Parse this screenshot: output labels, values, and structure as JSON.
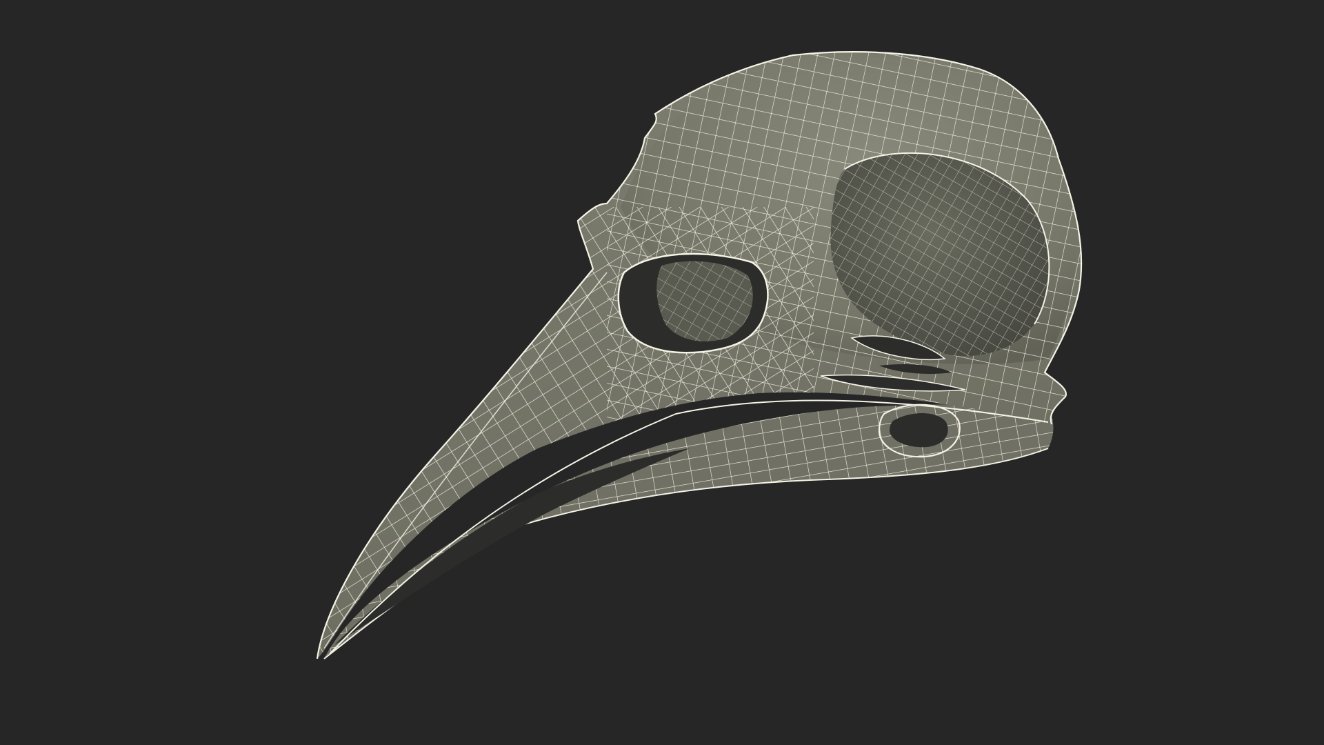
{
  "scene": {
    "subject": "bird-skull-wireframe",
    "colors": {
      "background": "#262626",
      "surface": "#767769",
      "surface_light": "#8a8b7d",
      "surface_dark": "#5e5f53",
      "cavity": "#2c2c2a",
      "cavity_inner": "#55564c",
      "wire": "#f4f3e6"
    }
  }
}
